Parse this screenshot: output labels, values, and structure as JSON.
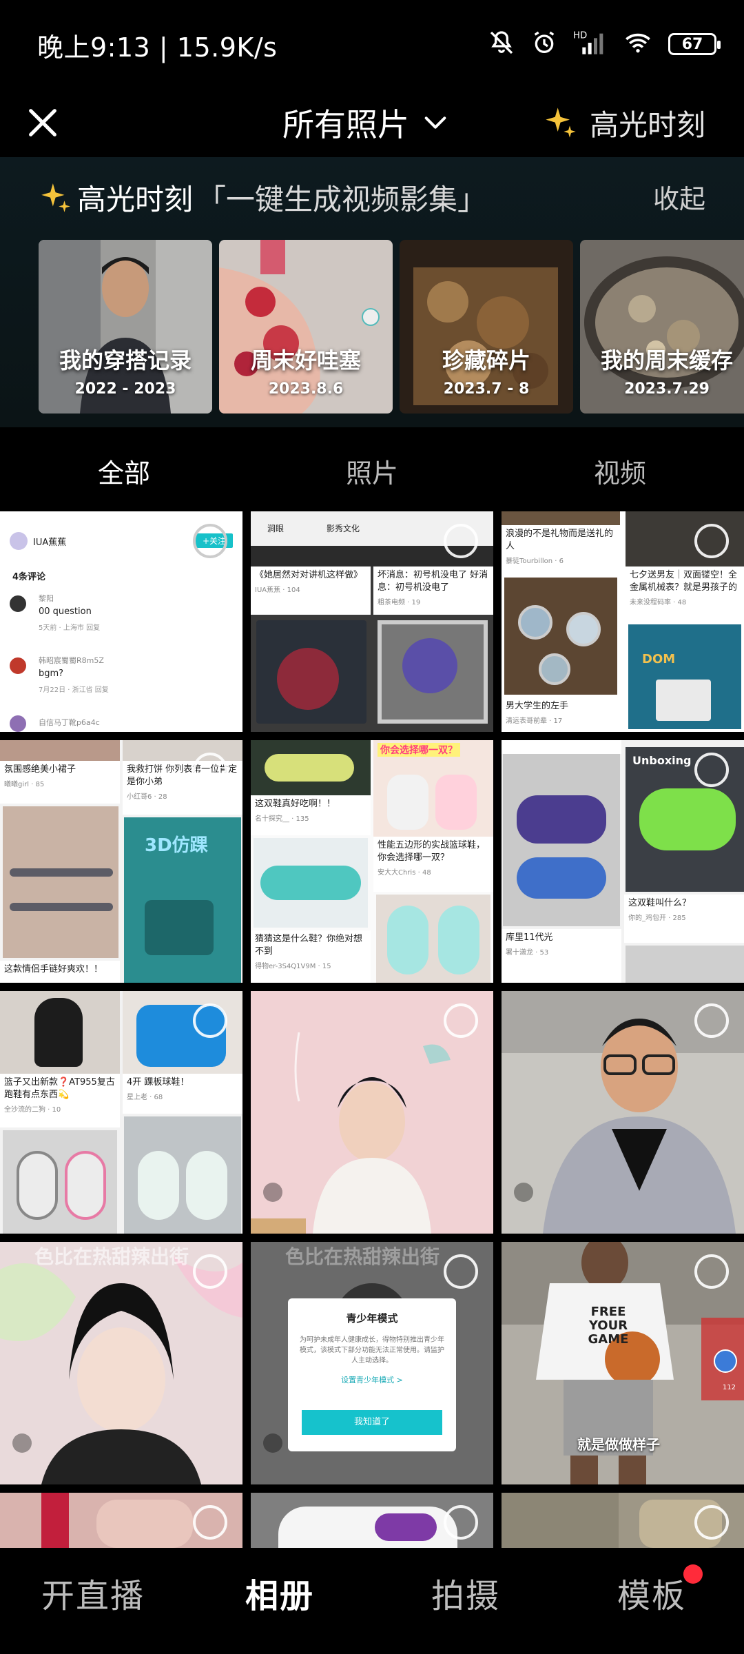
{
  "status_bar": {
    "text": "晚上9:13 | 15.9K/s",
    "battery": "67"
  },
  "top_bar": {
    "album_title": "所有照片",
    "highlight_label": "高光时刻"
  },
  "highlight_section": {
    "title": "高光时刻",
    "subtitle": "「一键生成视频影集」",
    "collapse_label": "收起",
    "cards": [
      {
        "title": "我的穿搭记录",
        "date": "2022 - 2023"
      },
      {
        "title": "周末好哇塞",
        "date": "2023.8.6"
      },
      {
        "title": "珍藏碎片",
        "date": "2023.7 - 8"
      },
      {
        "title": "我的周末缓存",
        "date": "2023.7.29"
      }
    ]
  },
  "tabs": [
    "全部",
    "照片",
    "视频"
  ],
  "grid": {
    "tile1": {
      "user": "IUA蕉蕉",
      "follow": "+关注",
      "comments_header": "4条评论",
      "comments": [
        {
          "name": "黎阳",
          "text": "00 question",
          "meta": "5天前 · 上海市 回复"
        },
        {
          "name": "韩昭宸蜀蜀R8m5Z",
          "text": "bgm?",
          "meta": "7月22日 · 浙江省 回复"
        },
        {
          "name": "自信马丁靴p6a4c",
          "text": "",
          "meta": ""
        }
      ]
    },
    "tile2": {
      "tags": [
        "涧眼",
        "影秀文化"
      ],
      "caps": [
        "《她居然对对讲机这样做》",
        "坏消息：初号机没电了 好消息：初号机没电了"
      ],
      "users": [
        "IUA蕉蕉",
        "粗茶电频"
      ],
      "likes": [
        "104",
        "19"
      ]
    },
    "tile3": {
      "caps": [
        "浪漫的不是礼物而是送礼的人",
        "七夕送男友｜双面镂空！全金属机械表？就是男孩子的",
        "男大学生的左手"
      ],
      "users": [
        "暴徒Tourbillon",
        "未来没程码率",
        "清运表哥前辈"
      ],
      "likes": [
        "6",
        "48",
        "17"
      ],
      "brand": "DOM"
    },
    "tile4": {
      "caps": [
        "氛围感绝美小裙子",
        "我救打饼 你列表第一位肯定是你小弟",
        "这款情侣手链好爽欢！！"
      ],
      "users": [
        "曦曦girl",
        "小红哥6"
      ],
      "likes": [
        "85",
        "28"
      ],
      "overlay": "3D仿踝"
    },
    "tile5": {
      "caps": [
        "这双鞋真好吃啊！！",
        "性能五边形的实战篮球鞋，你会选择哪一双？",
        "猜猜这是什么鞋？你绝对想不到"
      ],
      "users": [
        "名十探究__",
        "安大大Chris",
        "得物er-3S4Q1V9M"
      ],
      "likes": [
        "135",
        "48",
        "15"
      ],
      "overlay": "你会选择哪一双？"
    },
    "tile6": {
      "caps": [
        "库里11代光",
        "这双鞋叫什么？"
      ],
      "users": [
        "署十潇龙",
        "你的_鸡包开"
      ],
      "likes": [
        "53",
        "285"
      ],
      "overlay": "Unboxing"
    },
    "tile7": {
      "caps": [
        "篮子又出新款❓AT955复古跑鞋有点东西💫",
        "4开 踝板球鞋！"
      ],
      "users": [
        "全沙流的二狗",
        "星上老"
      ],
      "likes": [
        "10",
        "68"
      ]
    },
    "tile10": {
      "blurred_caption": "色比在热甜辣出街"
    },
    "tile11": {
      "dialog_title": "青少年模式",
      "dialog_text": "为呵护未成年人健康成长，得物特别推出青少年模式，该模式下部分功能无法正常使用。请监护人主动选择。",
      "dialog_link": "设置青少年模式 >",
      "dialog_button": "我知道了"
    },
    "tile12": {
      "shirt": "FREE YOUR GAME",
      "caption": "就是做做样子",
      "likes": "112"
    }
  },
  "bottom_nav": [
    "开直播",
    "相册",
    "拍摄",
    "模板"
  ]
}
